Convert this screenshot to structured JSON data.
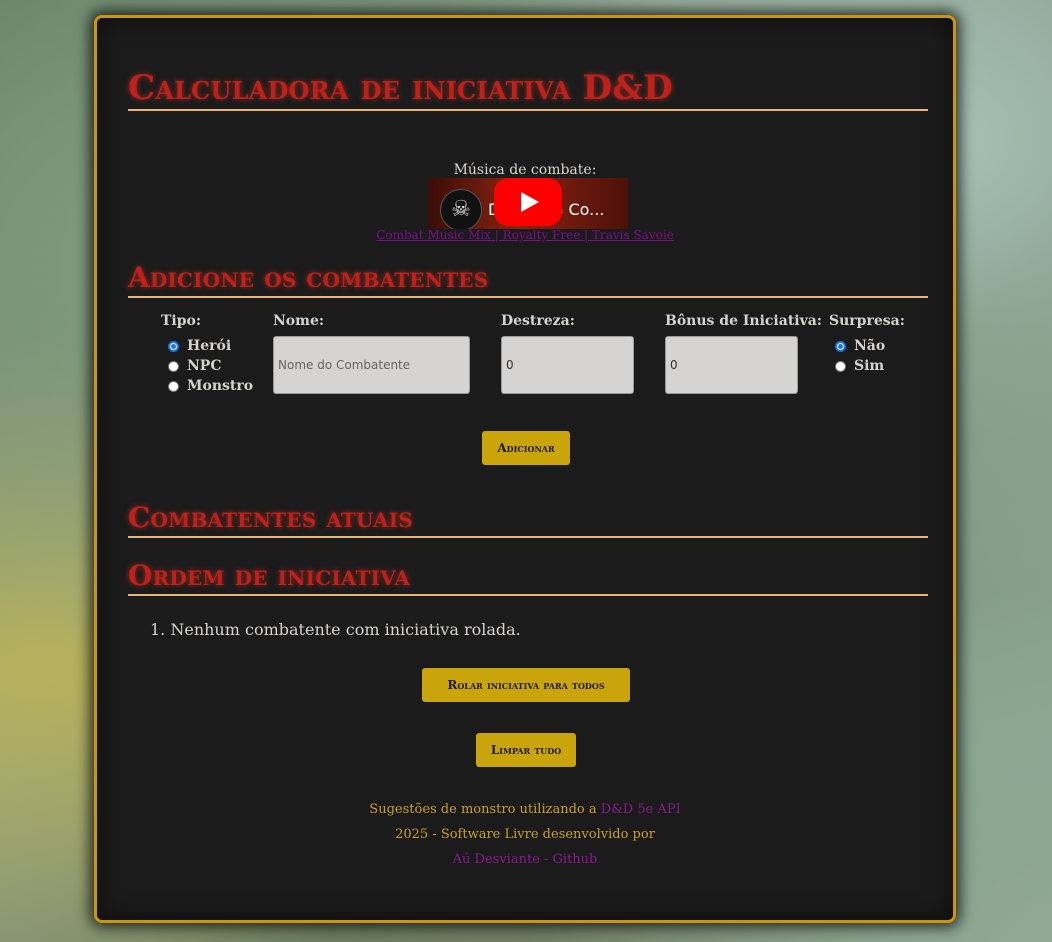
{
  "page": {
    "title": "Calculadora de iniciativa D&D"
  },
  "music": {
    "label": "Música de combate:",
    "video_title": "D&D RPG Co...",
    "video_link": "Combat Music Mix | Royalty Free | Travis Savoie"
  },
  "add_section": {
    "title": "Adicione os combatentes",
    "type": {
      "label": "Tipo:",
      "options": [
        "Herói",
        "NPC",
        "Monstro"
      ],
      "selected": "Herói"
    },
    "name": {
      "label": "Nome:",
      "placeholder": "Nome do Combatente",
      "value": ""
    },
    "dex": {
      "label": "Destreza:",
      "value": "0"
    },
    "init_bonus": {
      "label": "Bônus de Iniciativa:",
      "value": "0"
    },
    "surprise": {
      "label": "Surpresa:",
      "options": [
        "Não",
        "Sim"
      ],
      "selected": "Não"
    },
    "add_button": "Adicionar"
  },
  "current": {
    "title": "Combatentes atuais"
  },
  "order": {
    "title": "Ordem de iniciativa",
    "items": [
      "1. Nenhum combatente com iniciativa rolada."
    ],
    "roll_button": "Rolar iniciativa para todos",
    "clear_button": "Limpar tudo"
  },
  "footer": {
    "suggest_text": "Sugestões de monstro utilizando a",
    "api_link": "D&D 5e API",
    "credit_text": "2025 - Software Livre desenvolvido por",
    "author_link": "Aú Desviante - Github"
  },
  "colors": {
    "panel_border": "#c9960c",
    "title_red": "#c0201c",
    "button_gold": "#c9a40a",
    "link_purple": "#8b1a8f"
  }
}
